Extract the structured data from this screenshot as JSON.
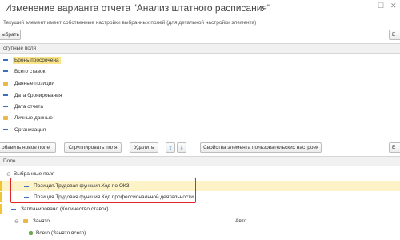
{
  "window": {
    "title": "Изменение варианта отчета \"Анализ штатного расписания\"",
    "more_icon": "more-vertical-icon",
    "maximize_icon": "maximize-icon",
    "close_icon": "close-icon"
  },
  "hint_text": "Текущий элемент имеет собственные настройки выбранных полей (для детальной настройки элемента)",
  "select_button": "ыбрать",
  "right_button_top": "Е",
  "available_fields": {
    "header": "ступные поля",
    "items": [
      {
        "label": "Бронь просрочена",
        "icon": "field-icon",
        "selected": true
      },
      {
        "label": "Всего ставок",
        "icon": "field-icon"
      },
      {
        "label": "Данные позиции",
        "icon": "folder-icon"
      },
      {
        "label": "Дата бронирования",
        "icon": "field-icon"
      },
      {
        "label": "Дата отчета",
        "icon": "field-icon"
      },
      {
        "label": "Личные данные",
        "icon": "folder-icon"
      },
      {
        "label": "Организация",
        "icon": "field-icon"
      }
    ]
  },
  "toolbar": {
    "add_new_field": "обавить новое поле",
    "group_fields": "Сгруппировать поля",
    "delete": "Удалить",
    "move_up": "⇧",
    "move_down": "⇩",
    "user_settings": "Свойства элемента пользовательских настроек",
    "right_button": "Е"
  },
  "selected_fields": {
    "header": "Поле",
    "root": "Выбранные поля",
    "rows": [
      {
        "label": "Позиция.Трудовая функция.Код по ОКЗ"
      },
      {
        "label": "Позиция.Трудовая функция.Код профессиональной деятельности"
      },
      {
        "label": "Запланировано (Количество ставок)"
      },
      {
        "label": "Занято",
        "placement": "Авто"
      },
      {
        "label": "Всего (Занято всего)"
      }
    ]
  },
  "colors": {
    "selection_highlight": "#fbe58b",
    "annotation_border": "#e0252b",
    "arrow_blue": "#2a78c8"
  }
}
